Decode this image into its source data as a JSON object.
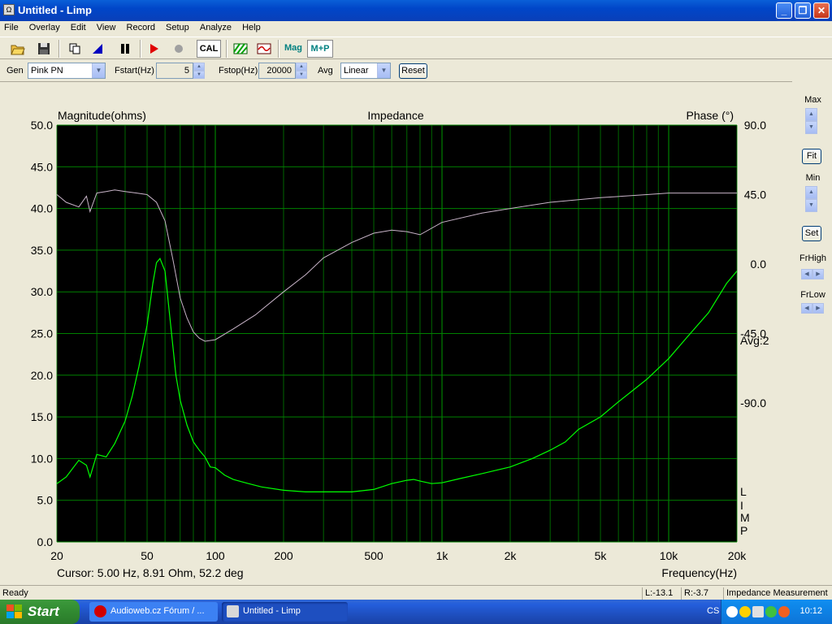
{
  "window": {
    "title": "Untitled - Limp",
    "app_icon": "limp-app-icon"
  },
  "menu": [
    "File",
    "Overlay",
    "Edit",
    "View",
    "Record",
    "Setup",
    "Analyze",
    "Help"
  ],
  "toolbar": {
    "cal_label": "CAL",
    "mag_label": "Mag",
    "mp_label": "M+P"
  },
  "params": {
    "gen_label": "Gen",
    "gen_value": "Pink PN",
    "fstart_label": "Fstart(Hz)",
    "fstart_value": "5",
    "fstop_label": "Fstop(Hz)",
    "fstop_value": "20000",
    "avg_label": "Avg",
    "avg_value": "Linear",
    "reset_label": "Reset"
  },
  "right_panel": {
    "max_label": "Max",
    "fit_label": "Fit",
    "min_label": "Min",
    "set_label": "Set",
    "frhigh_label": "FrHigh",
    "frlow_label": "FrLow"
  },
  "graph": {
    "left_axis_title": "Magnitude(ohms)",
    "title": "Impedance",
    "right_axis_title": "Phase (°)",
    "x_axis_title": "Frequency(Hz)",
    "cursor_text": "Cursor: 5.00 Hz, 8.91 Ohm, 52.2 deg",
    "avg_text": "Avg:2",
    "watermark": [
      "L",
      "I",
      "M",
      "P"
    ],
    "background_color": "#000000",
    "grid_color": "#008000",
    "magnitude_color": "#00ff00",
    "phase_color": "#c8b4c8"
  },
  "chart_data": {
    "type": "line",
    "title": "Impedance",
    "xlabel": "Frequency(Hz)",
    "ylabel": "Magnitude(ohms)",
    "y2label": "Phase (°)",
    "xscale": "log",
    "xlim": [
      20,
      20000
    ],
    "ylim": [
      0,
      50
    ],
    "y2lim": [
      -180,
      90
    ],
    "grid": true,
    "x_ticks": [
      20,
      50,
      100,
      200,
      500,
      1000,
      2000,
      5000,
      10000,
      20000
    ],
    "x_tick_labels": [
      "20",
      "50",
      "100",
      "200",
      "500",
      "1k",
      "2k",
      "5k",
      "10k",
      "20k"
    ],
    "y_ticks": [
      0,
      5,
      10,
      15,
      20,
      25,
      30,
      35,
      40,
      45,
      50
    ],
    "y_tick_labels": [
      "0.0",
      "5.0",
      "10.0",
      "15.0",
      "20.0",
      "25.0",
      "30.0",
      "35.0",
      "40.0",
      "45.0",
      "50.0"
    ],
    "y2_ticks": [
      90,
      45,
      0,
      -45,
      -90
    ],
    "y2_tick_labels": [
      "90.0",
      "45.0",
      "0.0",
      "-45.0",
      "-90.0"
    ],
    "series": [
      {
        "axis": "left",
        "color": "#00ff00",
        "x": [
          20,
          22,
          25,
          27,
          28,
          30,
          33,
          36,
          40,
          43,
          46,
          50,
          53,
          55,
          57,
          60,
          63,
          67,
          70,
          75,
          80,
          85,
          90,
          95,
          100,
          110,
          120,
          140,
          160,
          200,
          250,
          300,
          400,
          500,
          600,
          700,
          750,
          800,
          900,
          1000,
          1200,
          1500,
          2000,
          2500,
          3000,
          3500,
          4000,
          5000,
          6000,
          8000,
          10000,
          12000,
          15000,
          18000,
          20000
        ],
        "y": [
          7.0,
          7.8,
          9.8,
          9.2,
          7.8,
          10.5,
          10.2,
          11.8,
          14.5,
          17.5,
          21.0,
          26.0,
          31.0,
          33.5,
          34.0,
          32.5,
          27.0,
          20.0,
          17.0,
          14.0,
          12.0,
          11.0,
          10.2,
          9.0,
          8.9,
          8.0,
          7.5,
          7.0,
          6.6,
          6.2,
          6.0,
          6.0,
          6.0,
          6.3,
          7.0,
          7.4,
          7.5,
          7.3,
          7.0,
          7.1,
          7.6,
          8.2,
          9.0,
          10.0,
          11.0,
          12.0,
          13.5,
          15.0,
          16.8,
          19.5,
          22.0,
          24.5,
          27.5,
          31.0,
          32.5
        ]
      },
      {
        "axis": "right",
        "color": "#c8b4c8",
        "x": [
          20,
          22,
          25,
          27,
          28,
          30,
          33,
          36,
          40,
          45,
          50,
          55,
          60,
          65,
          70,
          75,
          80,
          85,
          90,
          100,
          120,
          150,
          200,
          250,
          300,
          400,
          500,
          600,
          700,
          800,
          1000,
          1500,
          2000,
          3000,
          5000,
          8000,
          10000,
          15000,
          20000
        ],
        "y": [
          45,
          40,
          37,
          44,
          34,
          46,
          47,
          48,
          47,
          46,
          45,
          40,
          28,
          3,
          -22,
          -35,
          -44,
          -48,
          -50,
          -49,
          -42,
          -33,
          -18,
          -7,
          4,
          14,
          20,
          22,
          21,
          19,
          27,
          33,
          36,
          40,
          43,
          45,
          46,
          46,
          46
        ]
      }
    ]
  },
  "status": {
    "ready": "Ready",
    "left_level": "L:-13.1",
    "right_level": "R:-3.7",
    "mode": "Impedance Measurement"
  },
  "taskbar": {
    "start_label": "Start",
    "items": [
      {
        "label": "Audioweb.cz Fórum / ..."
      },
      {
        "label": "Untitled - Limp"
      }
    ],
    "lang": "CS",
    "clock": "10:12"
  }
}
